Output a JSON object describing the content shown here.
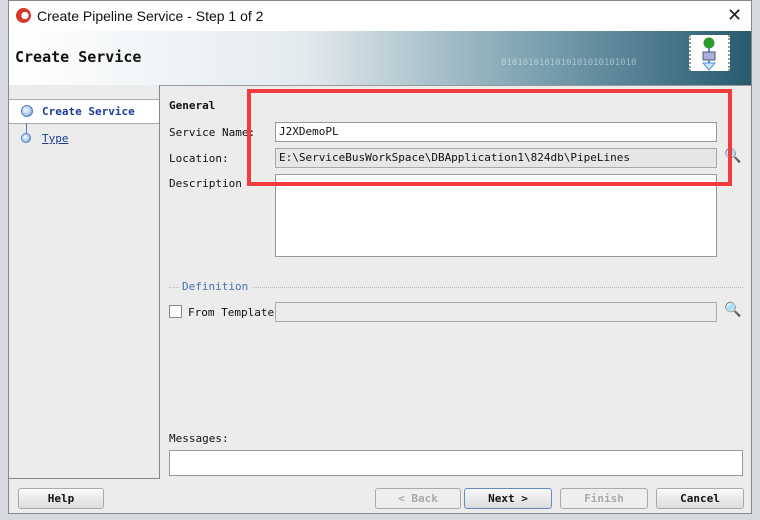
{
  "window": {
    "title": "Create Pipeline Service - Step 1 of 2",
    "close_icon": "close-icon"
  },
  "banner": {
    "title": "Create Service",
    "bits": "0101010101010101010101010"
  },
  "nav": {
    "items": [
      {
        "label": "Create Service",
        "selected": true
      },
      {
        "label": "Type",
        "selected": false
      }
    ]
  },
  "general": {
    "heading": "General",
    "service_name_label": "Service Name:",
    "service_name_value": "J2XDemoPL",
    "location_label": "Location:",
    "location_value": "E:\\ServiceBusWorkSpace\\DBApplication1\\824db\\PipeLines",
    "description_label": "Description",
    "description_value": ""
  },
  "definition": {
    "heading": "Definition",
    "from_template_label": "From Template",
    "from_template_checked": false,
    "template_value": ""
  },
  "messages": {
    "label": "Messages:",
    "value": ""
  },
  "buttons": {
    "help": "Help",
    "back": "< Back",
    "next": "Next >",
    "finish": "Finish",
    "cancel": "Cancel"
  },
  "colors": {
    "highlight": "#f23c3c",
    "link": "#1c3c9a"
  }
}
